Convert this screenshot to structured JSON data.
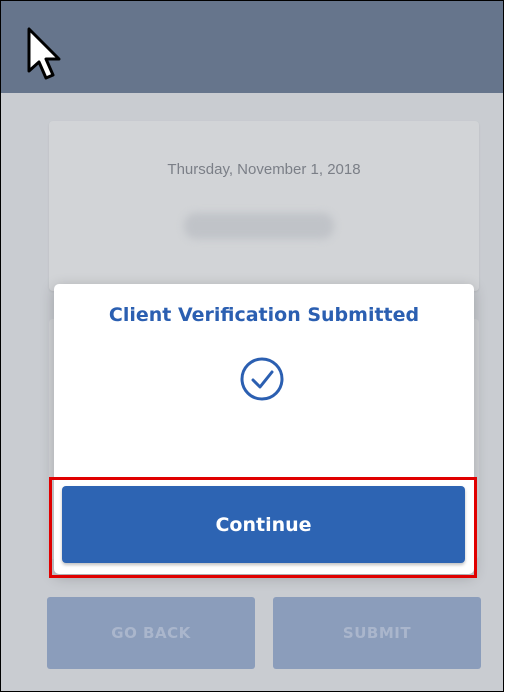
{
  "background": {
    "date": "Thursday, November 1, 2018",
    "go_back_label": "GO BACK",
    "submit_label": "SUBMIT"
  },
  "modal": {
    "title": "Client Verification Submitted",
    "status_icon": "check-circle-icon",
    "continue_label": "Continue"
  },
  "colors": {
    "header": "#66758c",
    "accent": "#2d64b3",
    "highlight": "#e00000"
  }
}
